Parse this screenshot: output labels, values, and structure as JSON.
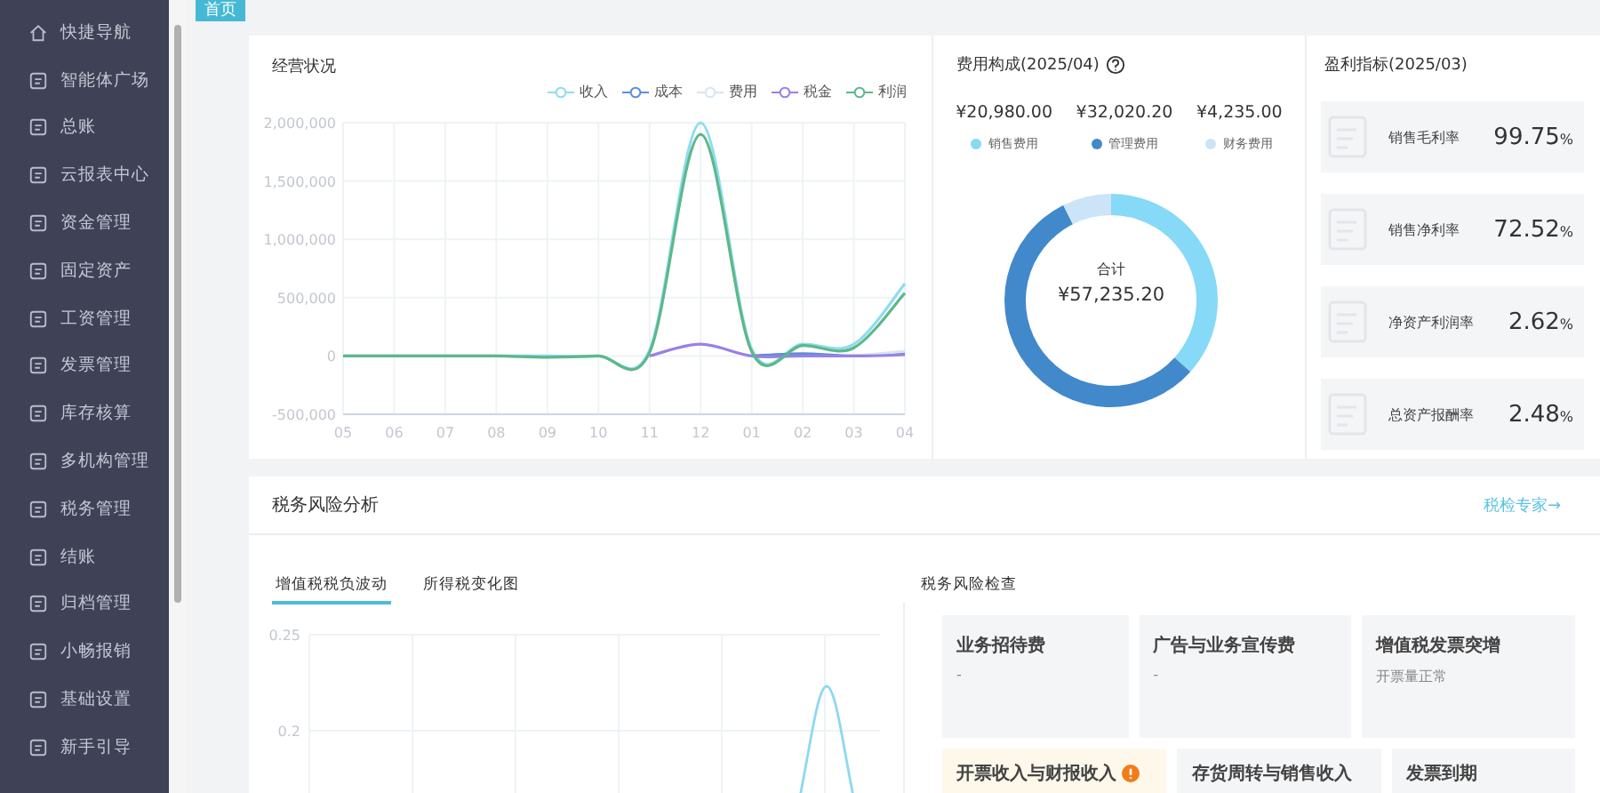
{
  "sidebar": {
    "items": [
      {
        "label": "快捷导航"
      },
      {
        "label": "智能体广场"
      },
      {
        "label": "总账"
      },
      {
        "label": "云报表中心"
      },
      {
        "label": "资金管理"
      },
      {
        "label": "固定资产"
      },
      {
        "label": "工资管理"
      },
      {
        "label": "发票管理"
      },
      {
        "label": "库存核算"
      },
      {
        "label": "多机构管理"
      },
      {
        "label": "税务管理"
      },
      {
        "label": "结账"
      },
      {
        "label": "归档管理"
      },
      {
        "label": "小畅报销"
      },
      {
        "label": "基础设置"
      },
      {
        "label": "新手引导"
      }
    ]
  },
  "tabs": [
    {
      "label": "首页",
      "selected": true
    }
  ],
  "operations": {
    "title": "经营状况",
    "chart_data": {
      "type": "line",
      "grid": true,
      "legend": true,
      "categories": [
        "05",
        "06",
        "07",
        "08",
        "09",
        "10",
        "11",
        "12",
        "01",
        "02",
        "03",
        "04"
      ],
      "ylim": [
        -500000,
        2000000
      ],
      "yticks": [
        {
          "value": -500000,
          "label": "-500,000"
        },
        {
          "value": 0,
          "label": "0"
        },
        {
          "value": 500000,
          "label": "500,000"
        },
        {
          "value": 1000000,
          "label": "1,000,000"
        },
        {
          "value": 1500000,
          "label": "1,500,000"
        },
        {
          "value": 2000000,
          "label": "2,000,000"
        }
      ],
      "series": [
        {
          "name": "收入",
          "color": "#8fdcf0",
          "values": [
            0,
            0,
            0,
            0,
            0,
            0,
            50000,
            2000000,
            60000,
            100000,
            100000,
            620000
          ]
        },
        {
          "name": "成本",
          "color": "#5b8fd6",
          "values": [
            null,
            null,
            null,
            null,
            null,
            null,
            null,
            null,
            0,
            20000,
            0,
            30000
          ]
        },
        {
          "name": "费用",
          "color": "#d6e6f2",
          "values": [
            null,
            null,
            null,
            null,
            null,
            null,
            null,
            null,
            null,
            null,
            0,
            40000
          ]
        },
        {
          "name": "税金",
          "color": "#9b7fe6",
          "values": [
            null,
            null,
            null,
            null,
            null,
            null,
            0,
            100000,
            0,
            0,
            0,
            10000
          ]
        },
        {
          "name": "利润",
          "color": "#5cb88a",
          "values": [
            0,
            0,
            0,
            0,
            -10000,
            0,
            30000,
            1900000,
            40000,
            90000,
            70000,
            540000
          ]
        }
      ]
    }
  },
  "expenses": {
    "title": "费用构成(2025/04)",
    "items": [
      {
        "amount": "¥20,980.00",
        "color": "#86d9f7"
      },
      {
        "amount": "¥32,020.20",
        "color": "#4189cb"
      },
      {
        "amount": "¥4,235.00",
        "color": "#cce4f8"
      }
    ],
    "total_label": "合计",
    "total": "¥57,235.20",
    "chart_data": {
      "type": "donut",
      "categories": [
        "销售费用",
        "管理费用",
        "财务费用"
      ],
      "values": [
        36.66,
        55.94,
        7.4
      ]
    }
  },
  "profit": {
    "title": "盈利指标(2025/03)",
    "items": [
      {
        "label": "销售毛利率",
        "value": "99.75",
        "unit": "%"
      },
      {
        "label": "销售净利率",
        "value": "72.52",
        "unit": "%"
      },
      {
        "label": "净资产利润率",
        "value": "2.62",
        "unit": "%"
      },
      {
        "label": "总资产报酬率",
        "value": "2.48",
        "unit": "%"
      }
    ]
  },
  "tax_risk": {
    "title": "税务风险分析",
    "link": "税检专家→",
    "tabs": [
      {
        "label": "增值税税负波动",
        "selected": true
      },
      {
        "label": "所得税变化图",
        "selected": false
      }
    ],
    "chart_ticks": [
      "0.25",
      "0.2"
    ],
    "check_title": "税务风险检查",
    "checks": [
      [
        {
          "title": "业务招待费",
          "detail": "-",
          "warning": false
        },
        {
          "title": "广告与业务宣传费",
          "detail": "-",
          "warning": false
        },
        {
          "title": "增值税发票突增",
          "detail": "开票量正常",
          "warning": false
        }
      ],
      [
        {
          "title": "开票收入与财报收入",
          "warning": true
        },
        {
          "title": "存货周转与销售收入",
          "warning": false
        },
        {
          "title": "发票到期",
          "warning": false
        }
      ]
    ]
  }
}
